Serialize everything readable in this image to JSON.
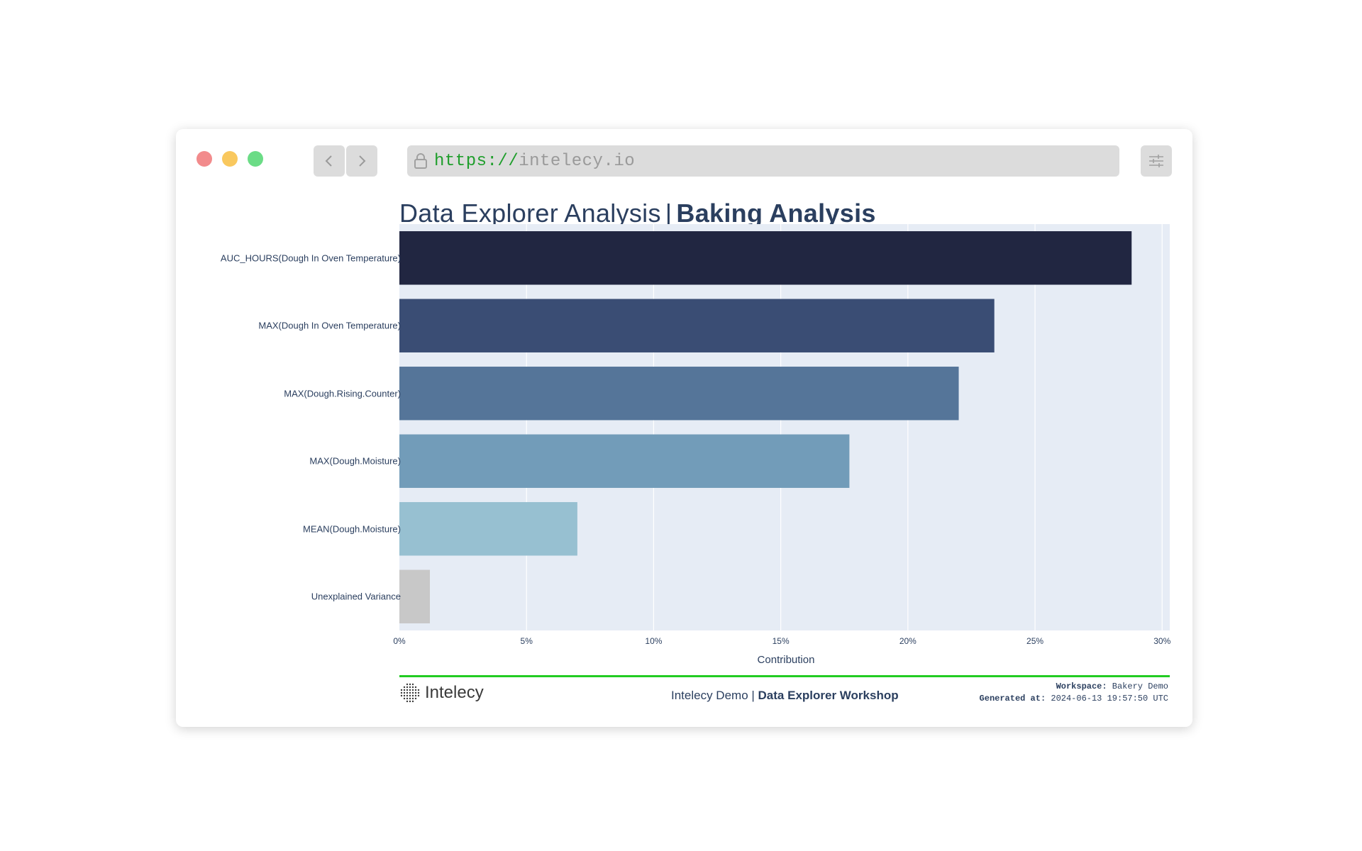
{
  "browser": {
    "url_scheme": "https://",
    "url_host": "intelecy.io"
  },
  "page": {
    "title_light": "Data Explorer Analysis",
    "title_sep": "|",
    "title_bold": "Baking Analysis"
  },
  "chart_data": {
    "type": "bar",
    "orientation": "horizontal",
    "categories": [
      "AUC_HOURS(Dough In Oven Temperature)",
      "MAX(Dough In Oven Temperature)",
      "MAX(Dough.Rising.Counter)",
      "MAX(Dough.Moisture)",
      "MEAN(Dough.Moisture)",
      "Unexplained Variance"
    ],
    "values": [
      28.8,
      23.4,
      22.0,
      17.7,
      7.0,
      1.2
    ],
    "colors": [
      "#212641",
      "#3a4d74",
      "#557599",
      "#729cb9",
      "#97c0d1",
      "#c8c8c8"
    ],
    "xlabel": "Contribution",
    "xticks": [
      "0%",
      "5%",
      "10%",
      "15%",
      "20%",
      "25%",
      "30%"
    ],
    "xlim": [
      0,
      30.3
    ],
    "grid": true,
    "plot_bg": "#e6ecf5"
  },
  "footer": {
    "logo_text": "Intelecy",
    "center_light": "Intelecy Demo | ",
    "center_bold": "Data Explorer Workshop",
    "workspace_key": "Workspace:",
    "workspace_val": " Bakery Demo",
    "generated_key": "Generated at:",
    "generated_val": " 2024-06-13 19:57:50 UTC",
    "accent": "#22cc22"
  }
}
